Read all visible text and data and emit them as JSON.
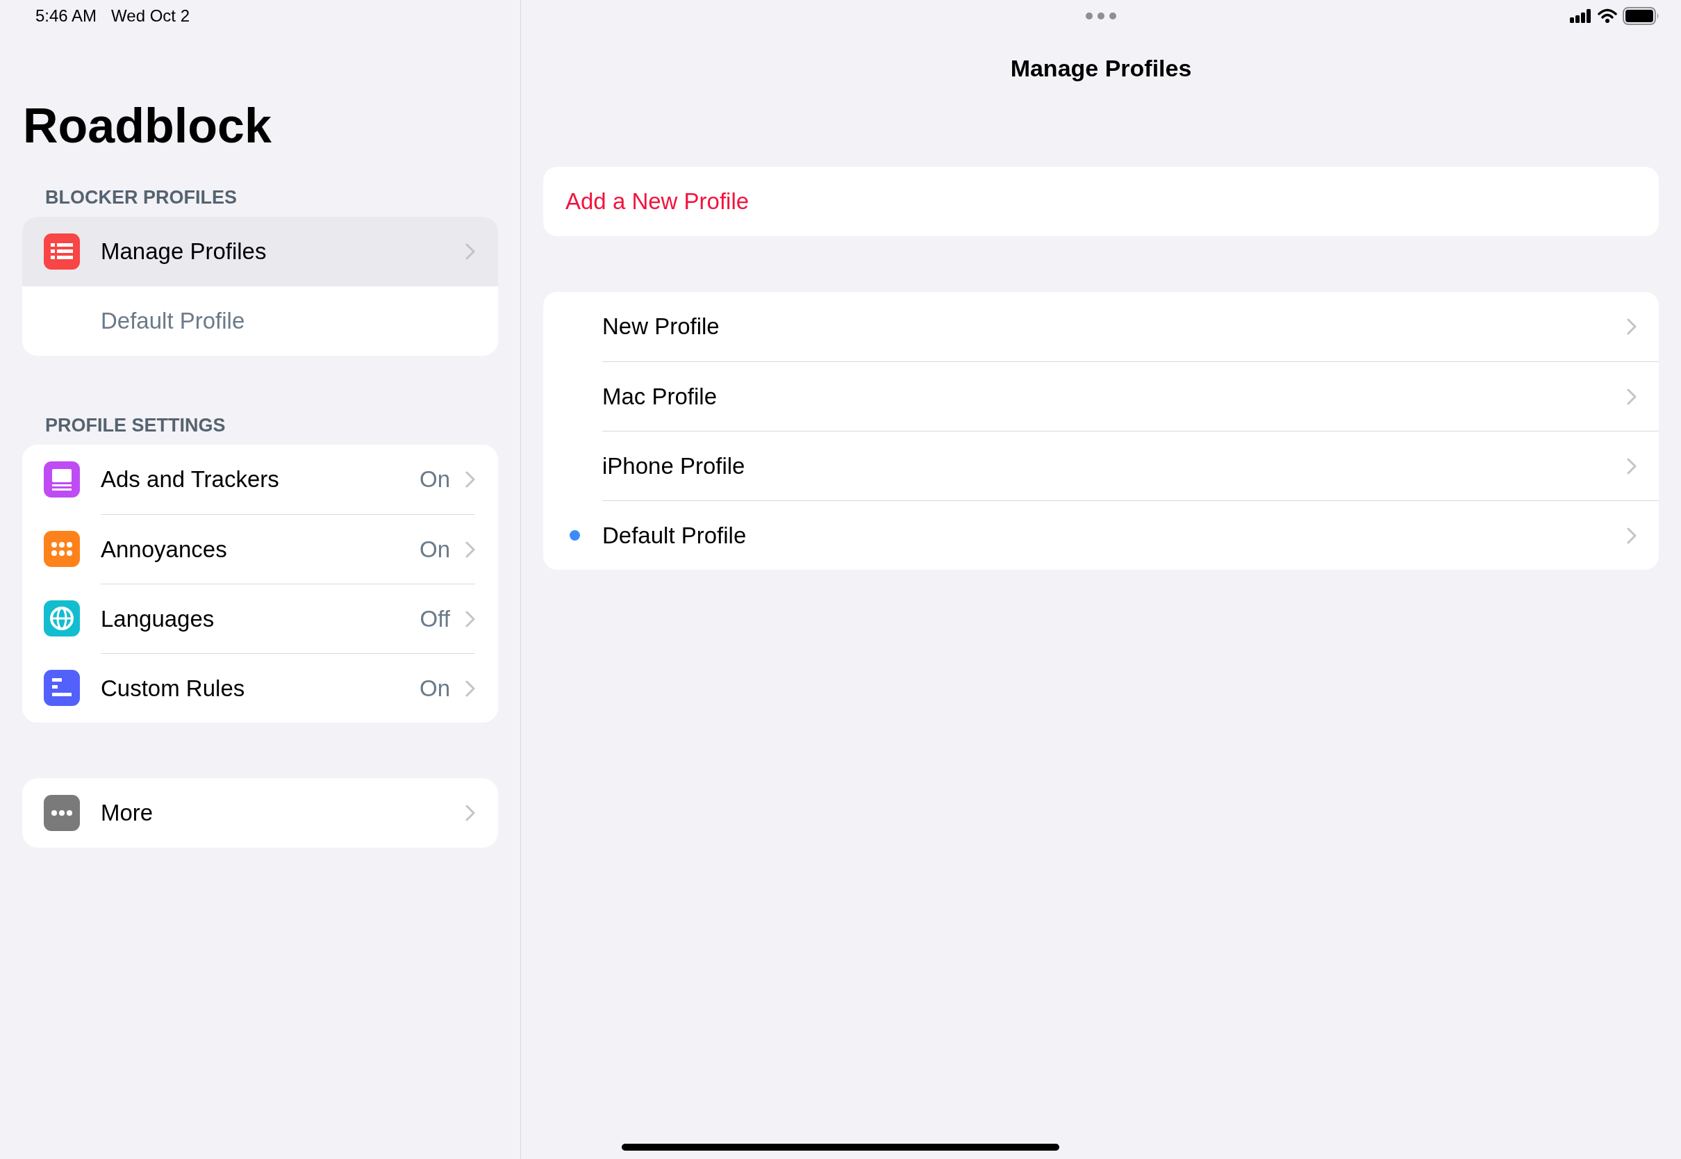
{
  "status_bar": {
    "time": "5:46 AM",
    "date": "Wed Oct 2"
  },
  "sidebar": {
    "title": "Roadblock",
    "sections": [
      {
        "header": "BLOCKER PROFILES",
        "items": [
          {
            "label": "Manage Profiles",
            "selected": true,
            "color": "#f84545"
          },
          {
            "label": "Default Profile",
            "selected": false,
            "kind": "subtitle"
          }
        ]
      },
      {
        "header": "PROFILE SETTINGS",
        "items": [
          {
            "label": "Ads and Trackers",
            "value": "On",
            "selected": false,
            "color": "#bf4bf5"
          },
          {
            "label": "Annoyances",
            "value": "On",
            "selected": false,
            "color": "#fd821b"
          },
          {
            "label": "Languages",
            "value": "Off",
            "selected": false,
            "color": "#12bdcf"
          },
          {
            "label": "Custom Rules",
            "value": "On",
            "selected": false,
            "color": "#5260fc"
          }
        ]
      },
      {
        "items": [
          {
            "label": "More",
            "selected": false,
            "color": "#7a7a7a"
          }
        ]
      }
    ]
  },
  "detail": {
    "title": "Manage Profiles",
    "add_button": "Add a New Profile",
    "profiles": [
      {
        "name": "New Profile",
        "active": false
      },
      {
        "name": "Mac Profile",
        "active": false
      },
      {
        "name": "iPhone Profile",
        "active": false
      },
      {
        "name": "Default Profile",
        "active": true
      }
    ]
  }
}
